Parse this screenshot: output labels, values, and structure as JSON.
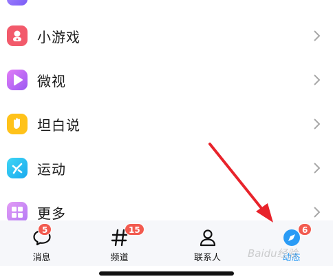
{
  "menu": {
    "items": [
      {
        "label": "小游戏",
        "icon": "game-controller-icon",
        "color": "#f25a6b"
      },
      {
        "label": "微视",
        "icon": "play-icon",
        "color": "#c36af5"
      },
      {
        "label": "坦白说",
        "icon": "hand-icon",
        "color": "#ffc21a"
      },
      {
        "label": "运动",
        "icon": "running-icon",
        "color": "#26c3f0"
      },
      {
        "label": "更多",
        "icon": "grid-icon",
        "color": "#c78cf7"
      }
    ]
  },
  "tabbar": {
    "tabs": [
      {
        "label": "消息",
        "badge": "5",
        "icon": "message-bubble-icon"
      },
      {
        "label": "频道",
        "badge": "15",
        "icon": "hashtag-icon"
      },
      {
        "label": "联系人",
        "badge": "",
        "icon": "person-icon"
      },
      {
        "label": "动态",
        "badge": "6",
        "icon": "star-compass-icon",
        "active": true
      }
    ],
    "active_color": "#2a9bf5",
    "badge_color": "#f25a4f"
  },
  "watermark": {
    "text": "Baidu经验"
  }
}
